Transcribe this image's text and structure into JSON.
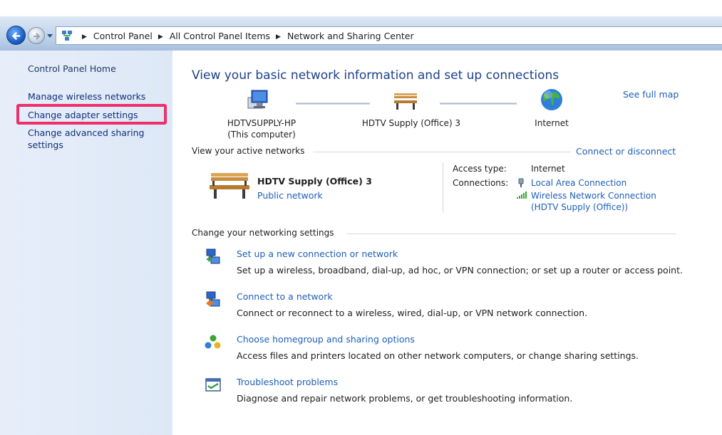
{
  "window": {
    "breadcrumbs": [
      "Control Panel",
      "All Control Panel Items",
      "Network and Sharing Center"
    ]
  },
  "sidebar": {
    "home": "Control Panel Home",
    "links": [
      {
        "label": "Manage wireless networks"
      },
      {
        "label": "Change adapter settings",
        "highlighted": true
      },
      {
        "label": "Change advanced sharing settings"
      }
    ],
    "highlight_color": "#ee2f6a"
  },
  "main": {
    "title": "View your basic network information and set up connections",
    "see_full_map": "See full map",
    "map": {
      "computer_name": "HDTVSUPPLY-HP",
      "computer_sub": "(This computer)",
      "network_name": "HDTV Supply (Office)  3",
      "internet": "Internet"
    },
    "active_networks": {
      "heading": "View your active networks",
      "connect_link": "Connect or disconnect",
      "network_name": "HDTV Supply (Office)  3",
      "network_type": "Public network",
      "access_type_label": "Access type:",
      "access_type_value": "Internet",
      "connections_label": "Connections:",
      "connection_1": "Local Area Connection",
      "connection_2_line1": "Wireless Network Connection",
      "connection_2_line2": "(HDTV Supply (Office))"
    },
    "settings": {
      "heading": "Change your networking settings",
      "tasks": [
        {
          "icon": "new-connection-icon",
          "title": "Set up a new connection or network",
          "desc": "Set up a wireless, broadband, dial-up, ad hoc, or VPN connection; or set up a router or access point."
        },
        {
          "icon": "connect-network-icon",
          "title": "Connect to a network",
          "desc": "Connect or reconnect to a wireless, wired, dial-up, or VPN network connection."
        },
        {
          "icon": "homegroup-icon",
          "title": "Choose homegroup and sharing options",
          "desc": "Access files and printers located on other network computers, or change sharing settings."
        },
        {
          "icon": "troubleshoot-icon",
          "title": "Troubleshoot problems",
          "desc": "Diagnose and repair network problems, or get troubleshooting information."
        }
      ]
    }
  },
  "colors": {
    "link": "#1e5fb8",
    "title": "#1d3f8c",
    "sidebar_link": "#0f2f7a"
  }
}
